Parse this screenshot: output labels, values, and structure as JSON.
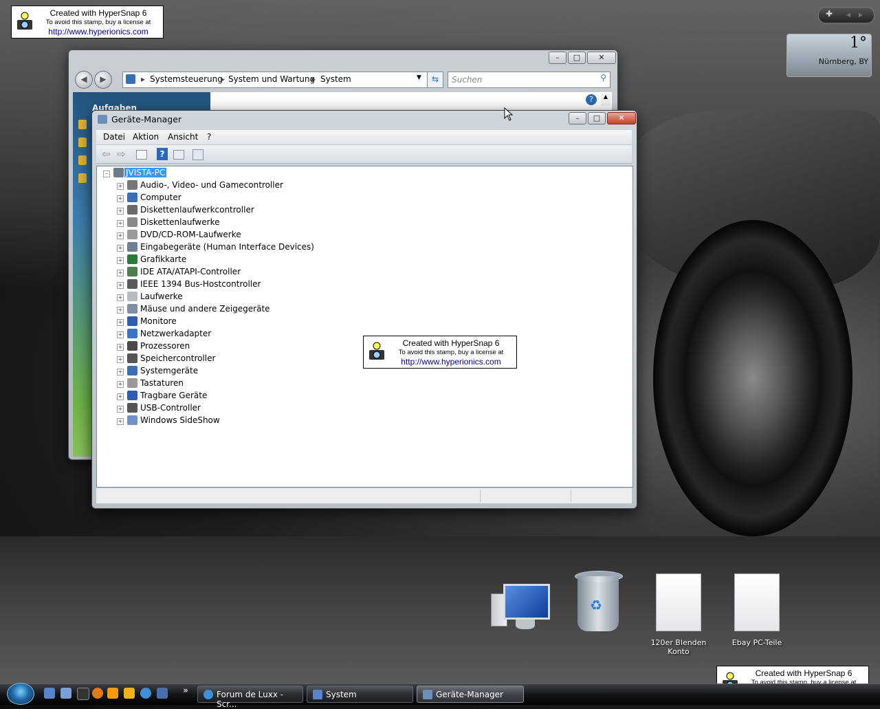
{
  "stamp": {
    "line1": "Created with HyperSnap 6",
    "line2": "To avoid this stamp, buy a license at",
    "line3": "http://www.hyperionics.com"
  },
  "weather": {
    "temp": "1°",
    "city": "Nürnberg, BY"
  },
  "system_window": {
    "breadcrumb": [
      "Systemsteuerung",
      "System und Wartung",
      "System"
    ],
    "search_placeholder": "Suchen",
    "sidebar_heading": "Aufgaben"
  },
  "device_manager": {
    "title": "Geräte-Manager",
    "menu": [
      "Datei",
      "Aktion",
      "Ansicht",
      "?"
    ],
    "root": "JVISTA-PC",
    "devices": [
      {
        "label": "Audio-, Video- und Gamecontroller",
        "icon": "speaker-icon"
      },
      {
        "label": "Computer",
        "icon": "computer-icon"
      },
      {
        "label": "Diskettenlaufwerkcontroller",
        "icon": "floppy-controller-icon"
      },
      {
        "label": "Diskettenlaufwerke",
        "icon": "floppy-drive-icon"
      },
      {
        "label": "DVD/CD-ROM-Laufwerke",
        "icon": "dvd-drive-icon"
      },
      {
        "label": "Eingabegeräte (Human Interface Devices)",
        "icon": "hid-icon"
      },
      {
        "label": "Grafikkarte",
        "icon": "display-adapter-icon"
      },
      {
        "label": "IDE ATA/ATAPI-Controller",
        "icon": "ide-controller-icon"
      },
      {
        "label": "IEEE 1394 Bus-Hostcontroller",
        "icon": "firewire-icon"
      },
      {
        "label": "Laufwerke",
        "icon": "disk-drive-icon"
      },
      {
        "label": "Mäuse und andere Zeigegeräte",
        "icon": "mouse-icon"
      },
      {
        "label": "Monitore",
        "icon": "monitor-icon"
      },
      {
        "label": "Netzwerkadapter",
        "icon": "network-adapter-icon"
      },
      {
        "label": "Prozessoren",
        "icon": "processor-icon"
      },
      {
        "label": "Speichercontroller",
        "icon": "storage-controller-icon"
      },
      {
        "label": "Systemgeräte",
        "icon": "system-devices-icon"
      },
      {
        "label": "Tastaturen",
        "icon": "keyboard-icon"
      },
      {
        "label": "Tragbare Geräte",
        "icon": "portable-device-icon"
      },
      {
        "label": "USB-Controller",
        "icon": "usb-icon"
      },
      {
        "label": "Windows SideShow",
        "icon": "sideshow-icon"
      }
    ]
  },
  "desktop_icons": [
    "120er Blenden Konto",
    "Ebay PC-Teile"
  ],
  "taskbar": {
    "overflow": "»",
    "buttons": [
      "Forum de Luxx - Scr...",
      "System",
      "Geräte-Manager"
    ]
  },
  "colors": {
    "selection": "#3399ff",
    "link": "#0000a0"
  }
}
